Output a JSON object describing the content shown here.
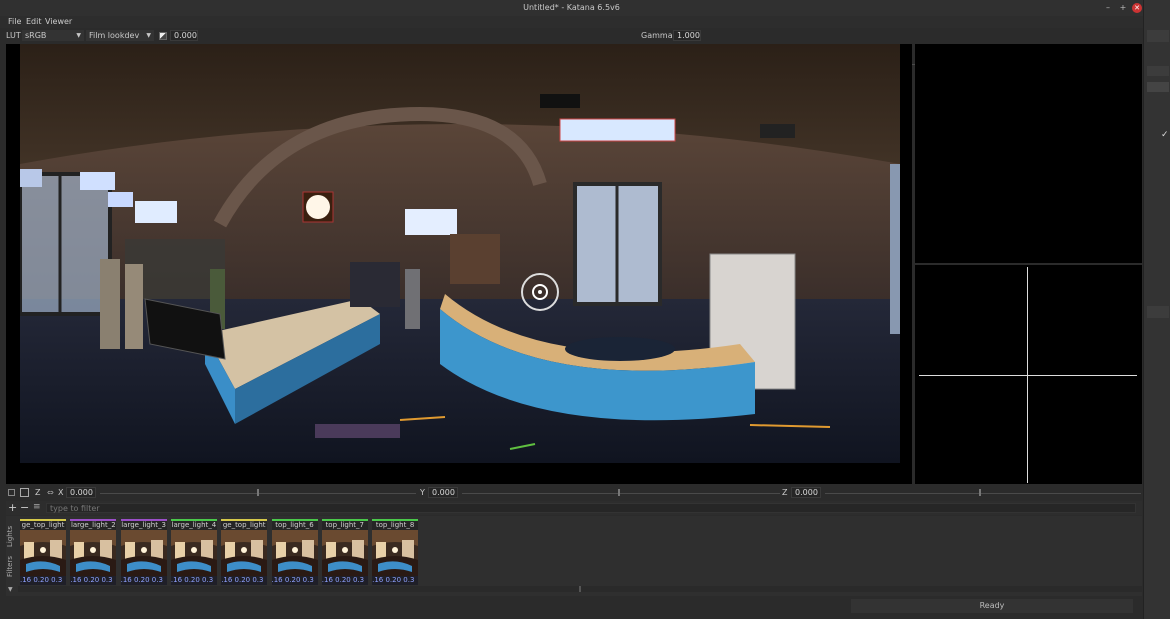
{
  "window": {
    "title": "Untitled* - Katana 6.5v6",
    "controls": [
      "minimize-icon",
      "maximize-icon",
      "close-icon"
    ]
  },
  "menu": [
    "File",
    "Edit",
    "Viewer"
  ],
  "toolbar": {
    "lut_label": "LUT",
    "lut_value": "sRGB",
    "display_value": "Film lookdev",
    "exposure_value": "0.000",
    "gamma_label": "Gamma",
    "gamma_value": "1.000"
  },
  "coords": {
    "x_label": "X",
    "x_value": "0.000",
    "y_label": "Y",
    "y_value": "0.000",
    "z_label": "Z",
    "z_value": "0.000",
    "z_toggle": "Z"
  },
  "filter": {
    "placeholder": "type to filter"
  },
  "side_tabs": [
    "Lights",
    "Filters"
  ],
  "lights": [
    {
      "name": "ge_top_light",
      "values": ".16 0.20 0.3",
      "accent": "#d4c84a"
    },
    {
      "name": "large_light_2",
      "values": ".16 0.20 0.3",
      "accent": "#9b4fc8"
    },
    {
      "name": "large_light_3",
      "values": ".16 0.20 0.3",
      "accent": "#9b4fc8"
    },
    {
      "name": "large_light_4",
      "values": ".16 0.20 0.3",
      "accent": "#4ac84a"
    },
    {
      "name": "ge_top_light",
      "values": ".16 0.20 0.3",
      "accent": "#d4c84a"
    },
    {
      "name": "top_light_6",
      "values": ".16 0.20 0.3",
      "accent": "#4ac84a"
    },
    {
      "name": "top_light_7",
      "values": ".16 0.20 0.3",
      "accent": "#4ac84a"
    },
    {
      "name": "top_light_8",
      "values": ".16 0.20 0.3",
      "accent": "#4ac84a"
    }
  ],
  "status": {
    "text": "Ready"
  },
  "colors": {
    "background": "#2b2b2b",
    "viewer": "#000000",
    "close": "#cc3333"
  }
}
